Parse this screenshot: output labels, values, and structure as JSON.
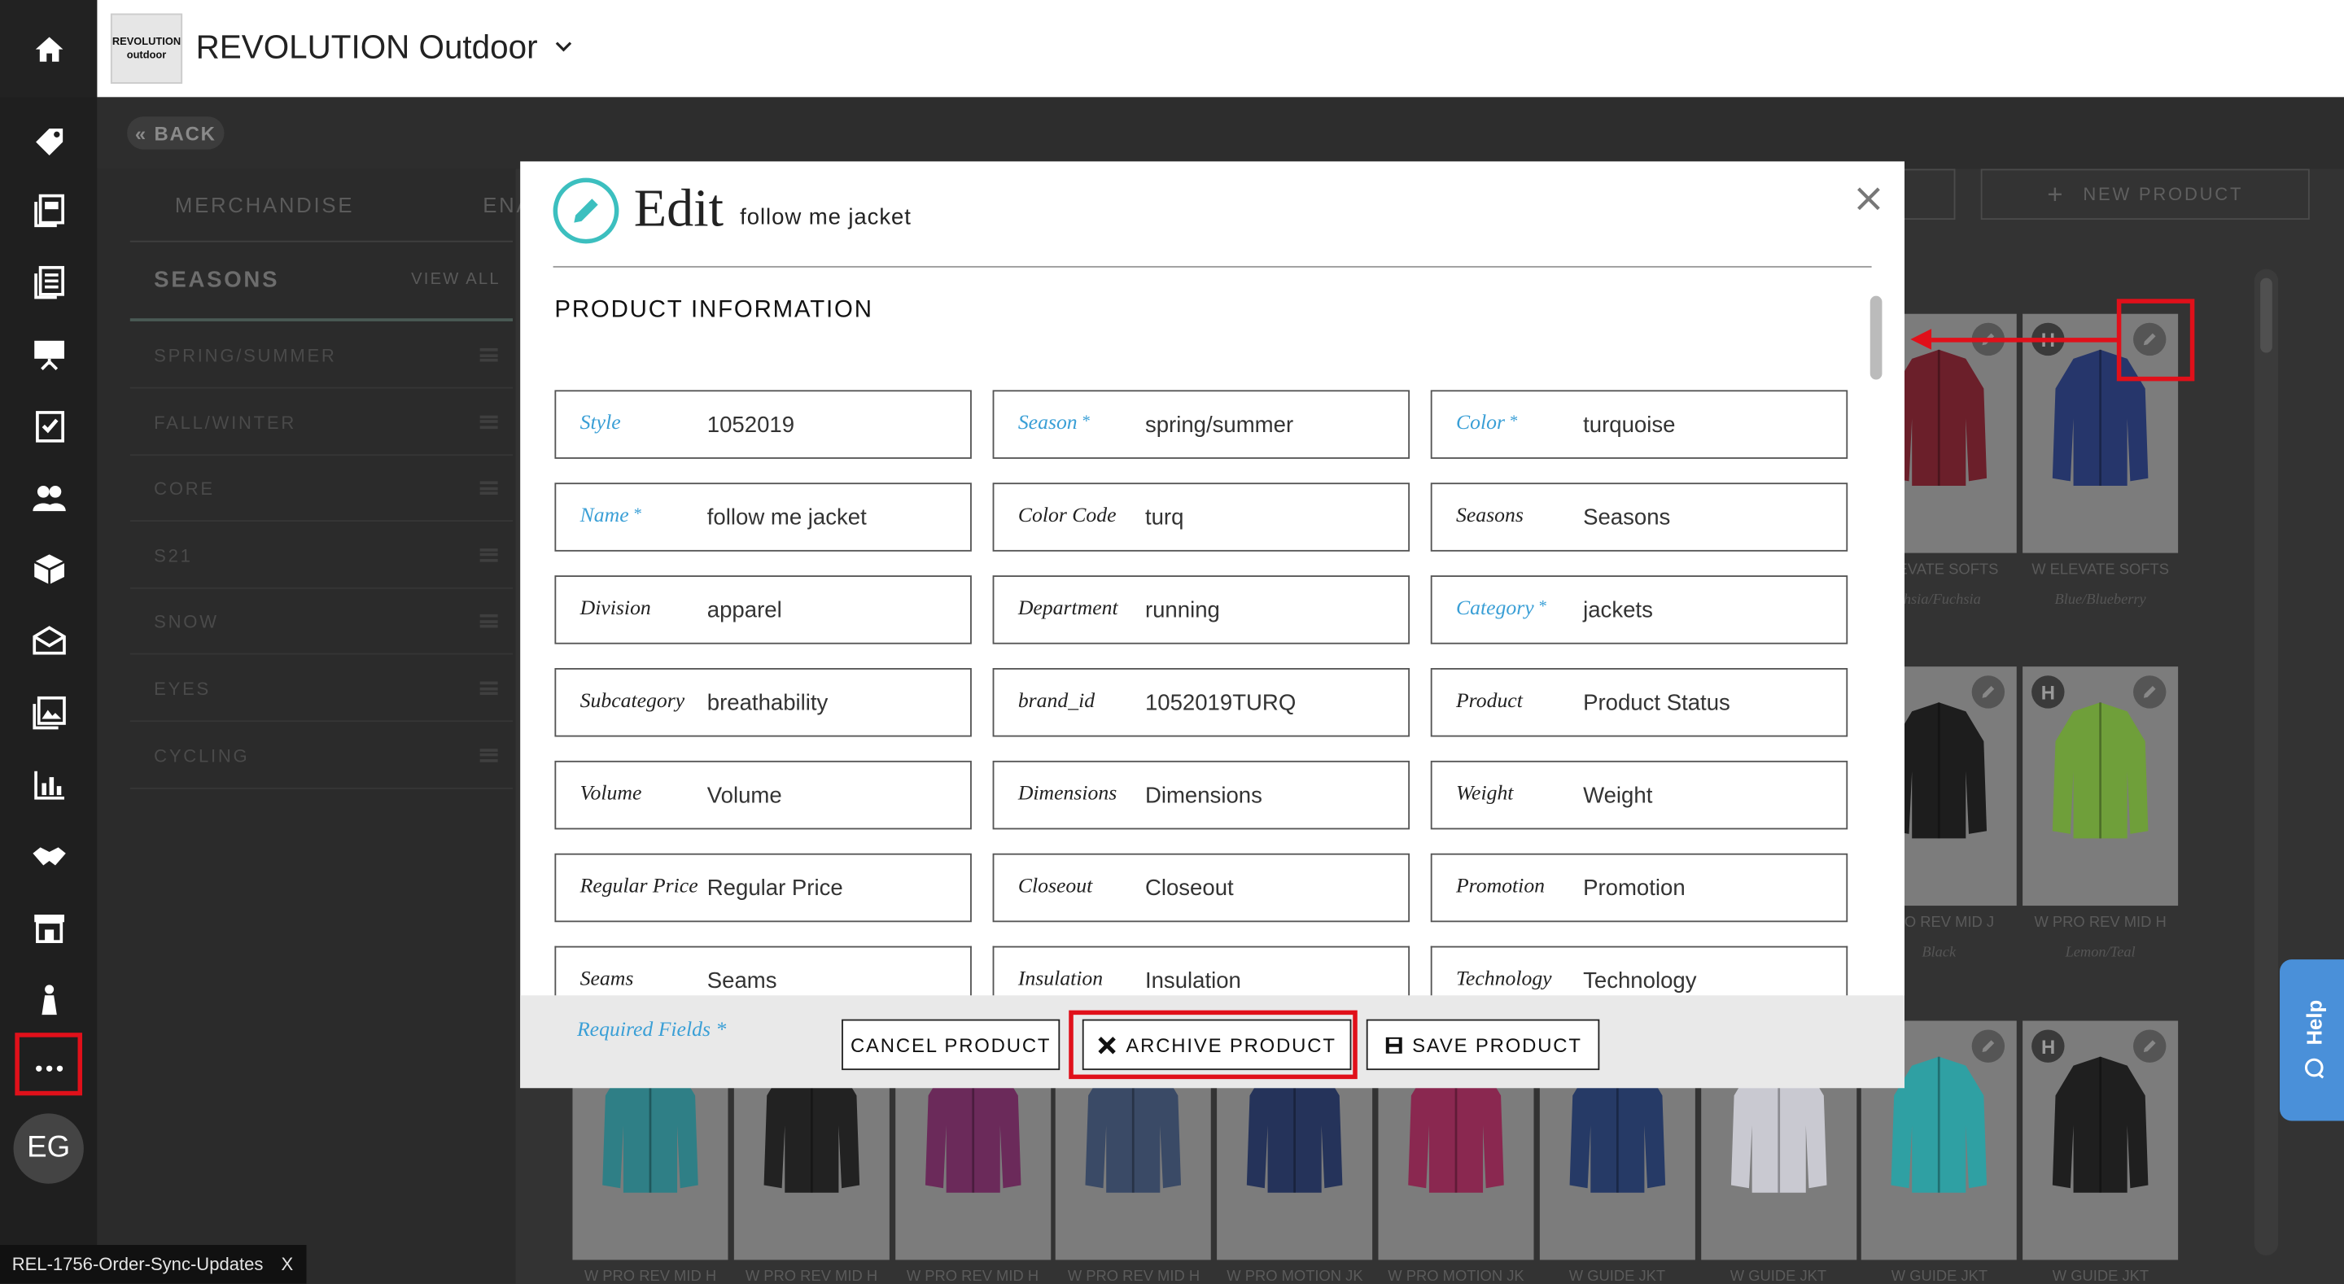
{
  "app": {
    "company": "REVOLUTION Outdoor",
    "logo_line1": "REVOLUTION",
    "logo_line2": "outdoor",
    "avatar": "EG"
  },
  "nav": {
    "back": "« BACK",
    "tabs": [
      "MERCHANDISE",
      "ENA"
    ],
    "new_product": "NEW PRODUCT"
  },
  "seasons": {
    "title": "SEASONS",
    "view_all": "VIEW ALL",
    "items": [
      "SPRING/SUMMER",
      "FALL/WINTER",
      "CORE",
      "S21",
      "SNOW",
      "EYES",
      "CYCLING"
    ]
  },
  "grid": {
    "row1": [
      {
        "label": "ELEVATE SOFTS",
        "sub": "chsia/Fuchsia",
        "color": "#6b1f2a"
      },
      {
        "label": "W ELEVATE SOFTS",
        "sub": "Blue/Blueberry",
        "color": "#26366b"
      }
    ],
    "row2": [
      {
        "label": "PRO REV MID J",
        "sub": "Black",
        "color": "#1d1d1d"
      },
      {
        "label": "W PRO REV MID H",
        "sub": "Lemon/Teal",
        "color": "#6f9f3a"
      }
    ],
    "row3": [
      {
        "label": "W PRO REV MID H",
        "color": "#2f7f86"
      },
      {
        "label": "W PRO REV MID H",
        "color": "#222"
      },
      {
        "label": "W PRO REV MID H",
        "color": "#6b2a5a"
      },
      {
        "label": "W PRO REV MID H",
        "color": "#3a4a66"
      },
      {
        "label": "W PRO MOTION JK",
        "color": "#25335a"
      },
      {
        "label": "W PRO MOTION JK",
        "color": "#8a2850"
      },
      {
        "label": "W GUIDE JKT",
        "color": "#263a66"
      },
      {
        "label": "W GUIDE JKT",
        "color": "#c9c9d1"
      },
      {
        "label": "W GUIDE JKT",
        "color": "#2fa0a3"
      },
      {
        "label": "W GUIDE JKT",
        "color": "#1f1f1f"
      }
    ]
  },
  "modal": {
    "title": "Edit",
    "subtitle": "follow me jacket",
    "section": "PRODUCT INFORMATION",
    "fields": [
      [
        {
          "label": "Style",
          "value": "1052019",
          "req": true,
          "star": false
        },
        {
          "label": "Season",
          "value": "spring/summer",
          "req": true,
          "star": true
        },
        {
          "label": "Color",
          "value": "turquoise",
          "req": true,
          "star": true
        }
      ],
      [
        {
          "label": "Name",
          "value": "follow me jacket",
          "req": true,
          "star": true
        },
        {
          "label": "Color Code",
          "value": "turq"
        },
        {
          "label": "Seasons",
          "value": "Seasons"
        }
      ],
      [
        {
          "label": "Division",
          "value": "apparel"
        },
        {
          "label": "Department",
          "value": "running"
        },
        {
          "label": "Category",
          "value": "jackets",
          "req": true,
          "star": true
        }
      ],
      [
        {
          "label": "Subcategory",
          "value": "breathability"
        },
        {
          "label": "brand_id",
          "value": "1052019TURQ"
        },
        {
          "label": "Product",
          "value": "Product Status"
        }
      ],
      [
        {
          "label": "Volume",
          "value": "Volume"
        },
        {
          "label": "Dimensions",
          "value": "Dimensions"
        },
        {
          "label": "Weight",
          "value": "Weight"
        }
      ],
      [
        {
          "label": "Regular Price",
          "value": "Regular Price"
        },
        {
          "label": "Closeout",
          "value": "Closeout"
        },
        {
          "label": "Promotion",
          "value": "Promotion"
        }
      ],
      [
        {
          "label": "Seams",
          "value": "Seams"
        },
        {
          "label": "Insulation",
          "value": "Insulation"
        },
        {
          "label": "Technology",
          "value": "Technology"
        }
      ]
    ],
    "required_note": "Required Fields *",
    "cancel": "CANCEL PRODUCT",
    "archive": "ARCHIVE PRODUCT",
    "save": "SAVE PRODUCT"
  },
  "help": "Help",
  "branch": {
    "name": "REL-1756-Order-Sync-Updates",
    "close": "X"
  },
  "colors": {
    "accent": "#3cbfbf",
    "required": "#3a9fd6",
    "highlight": "#e0101a",
    "help": "#4a90d9"
  }
}
